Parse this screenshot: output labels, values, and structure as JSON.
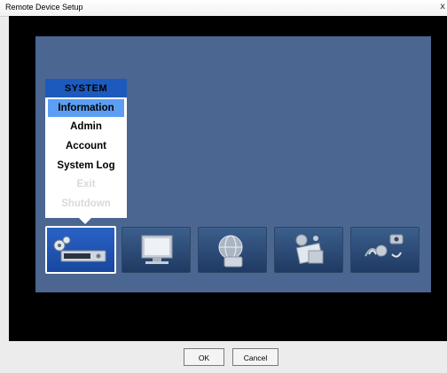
{
  "window": {
    "title": "Remote Device Setup",
    "close_glyph": "x"
  },
  "system_menu": {
    "header": "SYSTEM",
    "items": [
      {
        "label": "Information",
        "selected": true,
        "enabled": true
      },
      {
        "label": "Admin",
        "selected": false,
        "enabled": true
      },
      {
        "label": "Account",
        "selected": false,
        "enabled": true
      },
      {
        "label": "System Log",
        "selected": false,
        "enabled": true
      },
      {
        "label": "Exit",
        "selected": false,
        "enabled": false
      },
      {
        "label": "Shutdown",
        "selected": false,
        "enabled": false
      }
    ]
  },
  "categories": [
    {
      "icon": "system-device-icon",
      "selected": true
    },
    {
      "icon": "monitor-icon",
      "selected": false
    },
    {
      "icon": "network-globe-icon",
      "selected": false
    },
    {
      "icon": "event-notification-icon",
      "selected": false
    },
    {
      "icon": "camera-audio-icon",
      "selected": false
    }
  ],
  "dialog_buttons": {
    "ok_label": "OK",
    "cancel_label": "Cancel"
  },
  "colors": {
    "panel_blue": "#4a6691",
    "menu_header_blue": "#1c5bbd",
    "menu_selected": "#5b9ef2",
    "disabled_text": "#d9d9d9"
  }
}
